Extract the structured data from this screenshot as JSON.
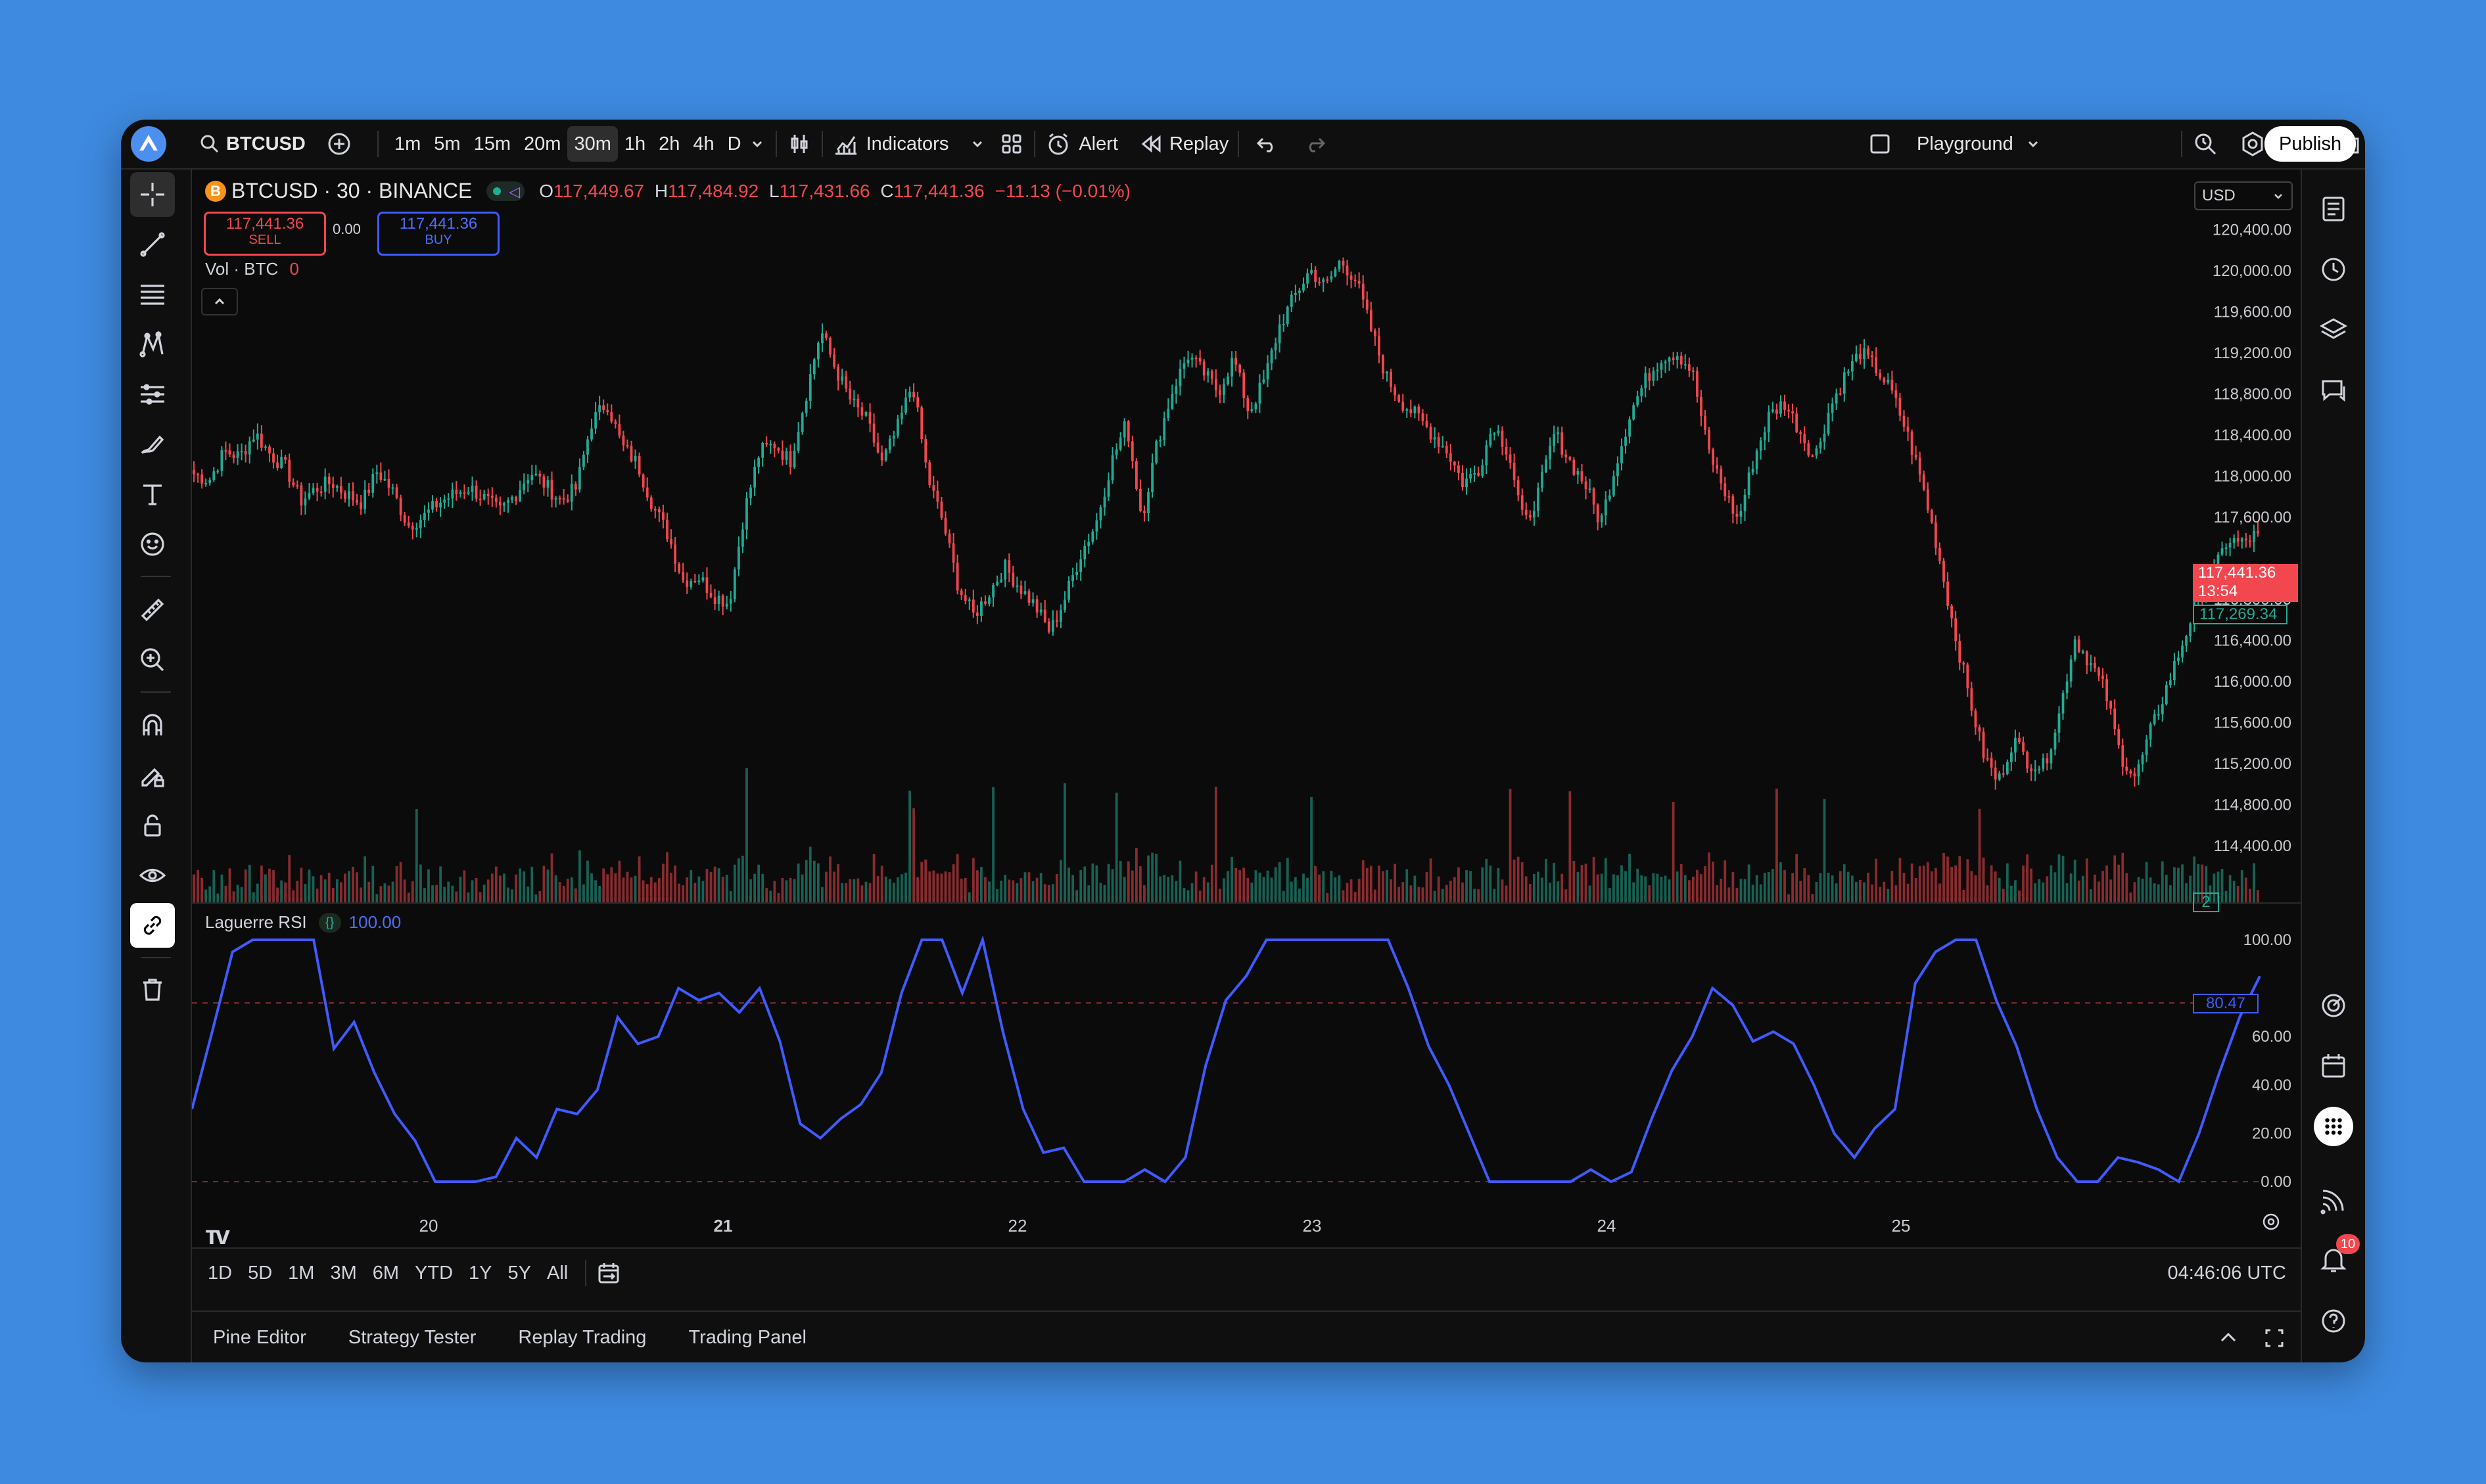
{
  "toolbar": {
    "symbol": "BTCUSD",
    "intervals": [
      "1m",
      "5m",
      "15m",
      "20m",
      "30m",
      "1h",
      "2h",
      "4h",
      "D"
    ],
    "active_interval": "30m",
    "indicators_label": "Indicators",
    "alert_label": "Alert",
    "replay_label": "Replay",
    "layout_name": "Playground",
    "publish_label": "Publish"
  },
  "legend": {
    "title": "BTCUSD · 30 · BINANCE",
    "o_label": "O",
    "o": "117,449.67",
    "h_label": "H",
    "h": "117,484.92",
    "l_label": "L",
    "l": "117,431.66",
    "c_label": "C",
    "c": "117,441.36",
    "change": "−11.13 (−0.01%)",
    "sell_price": "117,441.36",
    "sell_label": "SELL",
    "spread": "0.00",
    "buy_price": "117,441.36",
    "buy_label": "BUY",
    "vol_label": "Vol · BTC",
    "vol_value": "0",
    "rsi_label": "Laguerre RSI",
    "rsi_value": "100.00"
  },
  "price_axis": {
    "currency": "USD",
    "labels": [
      "120,400.00",
      "120,000.00",
      "119,600.00",
      "119,200.00",
      "118,800.00",
      "118,400.00",
      "118,000.00",
      "117,600.00",
      "116,800.00",
      "116,400.00",
      "116,000.00",
      "115,600.00",
      "115,200.00",
      "114,800.00",
      "114,400.00"
    ],
    "current_price": "117,441.36",
    "countdown": "13:54",
    "secondary_price": "117,269.34",
    "vol_badge": "2"
  },
  "rsi_axis": {
    "labels": [
      "100.00",
      "60.00",
      "40.00",
      "20.00",
      "0.00"
    ],
    "current": "80.47"
  },
  "date_axis": [
    "20",
    "21",
    "22",
    "23",
    "24",
    "25"
  ],
  "ranges": [
    "1D",
    "5D",
    "1M",
    "3M",
    "6M",
    "YTD",
    "1Y",
    "5Y",
    "All"
  ],
  "clock": "04:46:06 UTC",
  "panels": [
    "Pine Editor",
    "Strategy Tester",
    "Replay Trading",
    "Trading Panel"
  ],
  "notification_count": "10",
  "colors": {
    "up": "#22ab94",
    "down": "#f2474f",
    "rsi": "#3f5bff",
    "background": "#0b0b0b"
  },
  "chart_data": {
    "type": "candlestick",
    "price_ylim": [
      114200,
      120600
    ],
    "price_series": [
      118020,
      117960,
      118240,
      118190,
      118420,
      118210,
      118080,
      117760,
      117880,
      117940,
      117820,
      117740,
      118050,
      117850,
      117520,
      117600,
      117740,
      117820,
      117890,
      117780,
      117650,
      117820,
      118040,
      117910,
      117760,
      117880,
      118520,
      118720,
      118290,
      118120,
      117720,
      117430,
      116980,
      117020,
      116840,
      116760,
      117650,
      118240,
      118310,
      118140,
      118770,
      119420,
      119030,
      118720,
      118540,
      118120,
      118460,
      118910,
      117980,
      117550,
      116920,
      116640,
      116860,
      117120,
      116920,
      116740,
      116480,
      116820,
      117240,
      117540,
      118130,
      118520,
      117590,
      118320,
      118830,
      119180,
      119010,
      118820,
      119150,
      118620,
      118930,
      119460,
      119750,
      120010,
      119840,
      120100,
      119910,
      119420,
      118960,
      118720,
      118580,
      118410,
      118240,
      117930,
      118060,
      118510,
      118230,
      117510,
      117860,
      118420,
      118140,
      117920,
      117540,
      118120,
      118640,
      118950,
      119160,
      119200,
      119020,
      118270,
      117890,
      117560,
      118150,
      118580,
      118720,
      118450,
      118170,
      118660,
      118980,
      119210,
      119050,
      118830,
      118440,
      117950,
      117320,
      116590,
      115920,
      115310,
      115010,
      115440,
      115210,
      115170,
      115680,
      116420,
      116190,
      115910,
      115280,
      115060,
      115520,
      115930,
      116340,
      116780,
      117010,
      117380,
      117340,
      117441
    ],
    "rsi_ylim": [
      0,
      100
    ],
    "rsi_series": [
      30,
      62,
      95,
      100,
      100,
      100,
      100,
      55,
      66,
      45,
      28,
      17,
      0,
      0,
      0,
      2,
      18,
      10,
      30,
      28,
      38,
      68,
      57,
      60,
      80,
      75,
      78,
      70,
      80,
      58,
      24,
      18,
      26,
      32,
      45,
      78,
      100,
      100,
      78,
      100,
      62,
      30,
      12,
      14,
      0,
      0,
      0,
      5,
      0,
      10,
      48,
      75,
      85,
      100,
      100,
      100,
      100,
      100,
      100,
      100,
      80,
      56,
      40,
      20,
      0,
      0,
      0,
      0,
      0,
      5,
      0,
      4,
      26,
      46,
      60,
      80,
      73,
      58,
      62,
      57,
      40,
      20,
      10,
      22,
      30,
      82,
      95,
      100,
      100,
      75,
      56,
      30,
      10,
      0,
      0,
      10,
      8,
      5,
      0,
      20,
      45,
      68,
      85
    ]
  }
}
